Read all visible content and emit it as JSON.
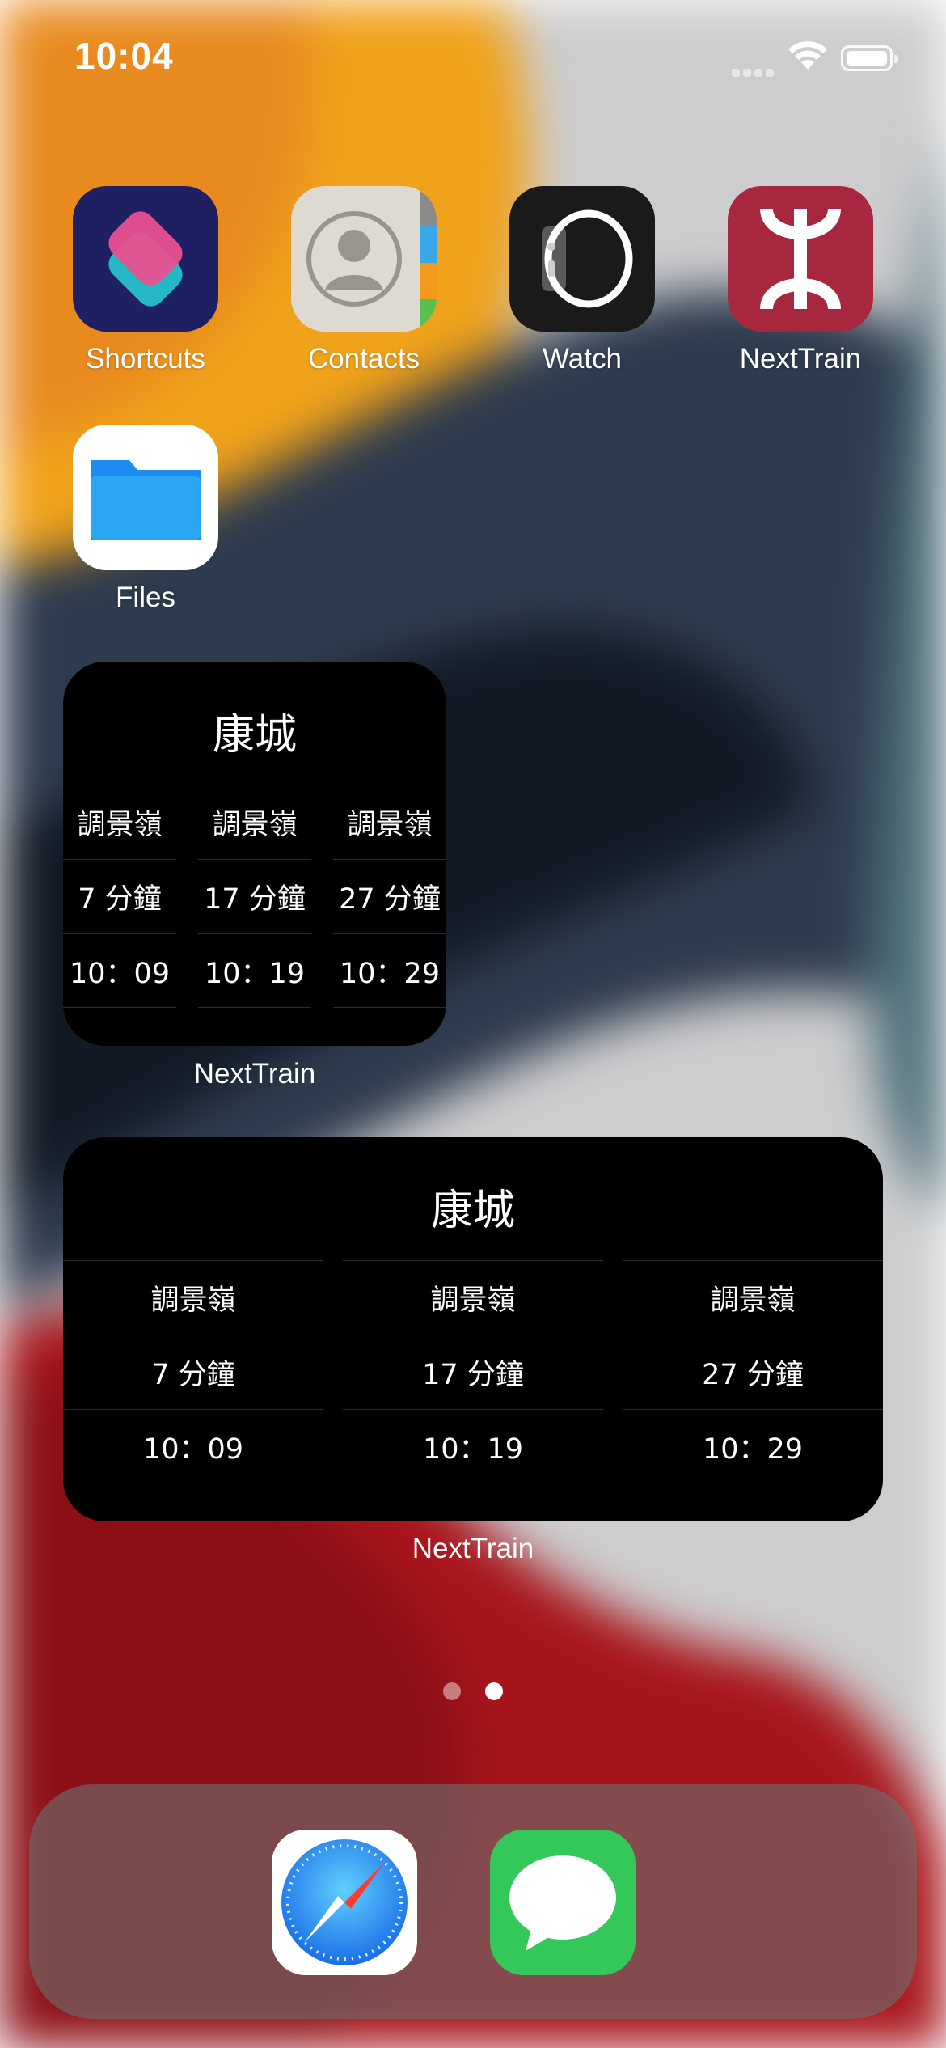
{
  "status_bar": {
    "time": "10:04"
  },
  "apps": [
    {
      "label": "Shortcuts",
      "icon": "shortcuts-icon"
    },
    {
      "label": "Contacts",
      "icon": "contacts-icon"
    },
    {
      "label": "Watch",
      "icon": "watch-icon"
    },
    {
      "label": "NextTrain",
      "icon": "mtr-logo-icon"
    },
    {
      "label": "Files",
      "icon": "folder-icon"
    }
  ],
  "widget_small": {
    "station": "康城",
    "columns": [
      {
        "destination": "調景嶺",
        "minutes": "7 分鐘",
        "time": "10：09"
      },
      {
        "destination": "調景嶺",
        "minutes": "17 分鐘",
        "time": "10：19"
      },
      {
        "destination": "調景嶺",
        "minutes": "27 分鐘",
        "time": "10：29"
      }
    ],
    "label": "NextTrain"
  },
  "widget_medium": {
    "station": "康城",
    "columns": [
      {
        "destination": "調景嶺",
        "minutes": "7 分鐘",
        "time": "10：09"
      },
      {
        "destination": "調景嶺",
        "minutes": "17 分鐘",
        "time": "10：19"
      },
      {
        "destination": "調景嶺",
        "minutes": "27 分鐘",
        "time": "10：29"
      }
    ],
    "label": "NextTrain"
  },
  "page_indicator": {
    "pages": 2,
    "current": 2
  },
  "dock": [
    {
      "icon": "safari-compass-icon"
    },
    {
      "icon": "messages-icon"
    }
  ],
  "colors": {
    "mtr_red": "#A7283E",
    "files_blue": "#1E8BF0",
    "messages_green": "#34C759",
    "widget_bg": "#000000"
  }
}
